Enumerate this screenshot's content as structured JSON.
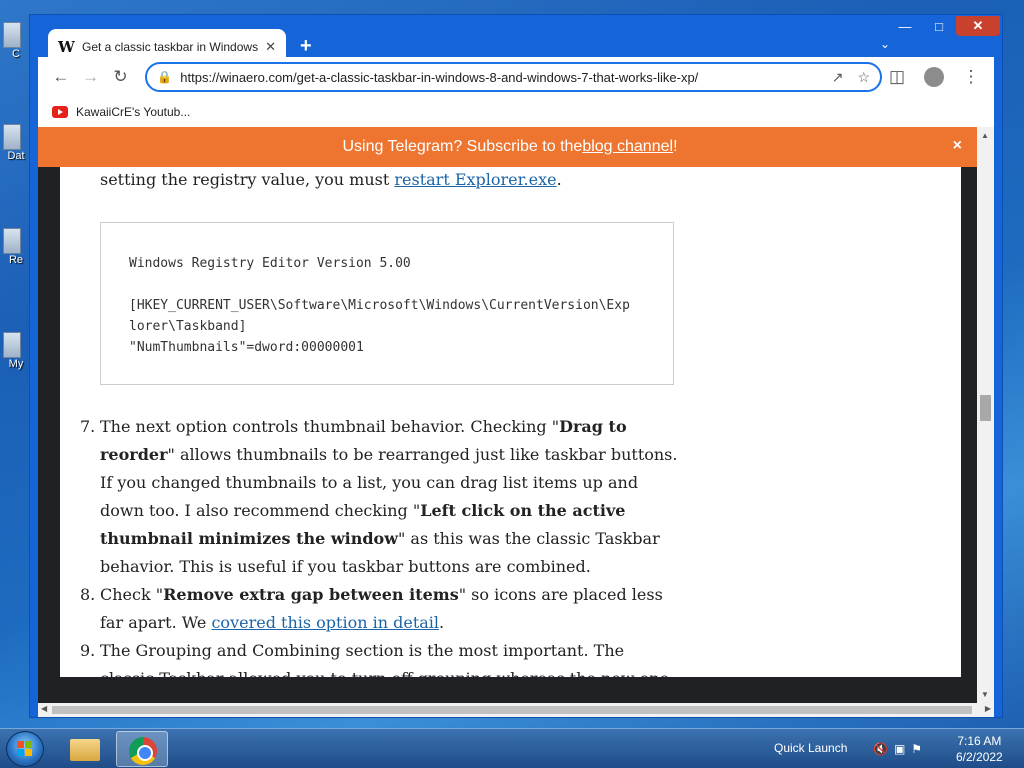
{
  "desktop": {
    "icons": [
      {
        "label": "C"
      },
      {
        "label": "Dat"
      },
      {
        "label": "Re"
      },
      {
        "label": "My"
      }
    ]
  },
  "browser": {
    "tab": {
      "title": "Get a classic taskbar in Windows",
      "favicon": "W"
    },
    "new_tab": "+",
    "omnibox": {
      "url": "https://winaero.com/get-a-classic-taskbar-in-windows-8-and-windows-7-that-works-like-xp/"
    },
    "bookmarks": [
      {
        "label": "KawaiiCrE's Youtub..."
      }
    ]
  },
  "page": {
    "banner": {
      "text": "Using Telegram? Subscribe to the ",
      "link": "blog channel",
      "suffix": "!",
      "close": "×"
    },
    "intro": {
      "text": "setting the registry value, you must ",
      "link": "restart Explorer.exe",
      "suffix": "."
    },
    "code": "Windows Registry Editor Version 5.00\n\n[HKEY_CURRENT_USER\\Software\\Microsoft\\Windows\\CurrentVersion\\Exp\nlorer\\Taskband]\n\"NumThumbnails\"=dword:00000001",
    "list": [
      {
        "num": "7.",
        "p1": "The next option controls thumbnail behavior. Checking \"",
        "b1": "Drag to reorder",
        "p2": "\" allows thumbnails to be rearranged just like taskbar buttons. If you changed thumbnails to a list, you can drag list items up and down too. I also recommend checking \"",
        "b2": "Left click on the active thumbnail minimizes the window",
        "p3": "\" as this was the classic Taskbar behavior. This is useful if you taskbar buttons are combined."
      },
      {
        "num": "8.",
        "p1": "Check \"",
        "b1": "Remove extra gap between items",
        "p2": "\" so icons are placed less far apart. We ",
        "link": "covered this option in detail",
        "p3": "."
      },
      {
        "num": "9.",
        "p1": "The Grouping and Combining section is the most important. The classic Taskbar allowed you to turn off grouping whereas the new one doesn't"
      }
    ]
  },
  "taskbar": {
    "quick_launch": "Quick Launch",
    "time": "7:16 AM",
    "date": "6/2/2022"
  }
}
